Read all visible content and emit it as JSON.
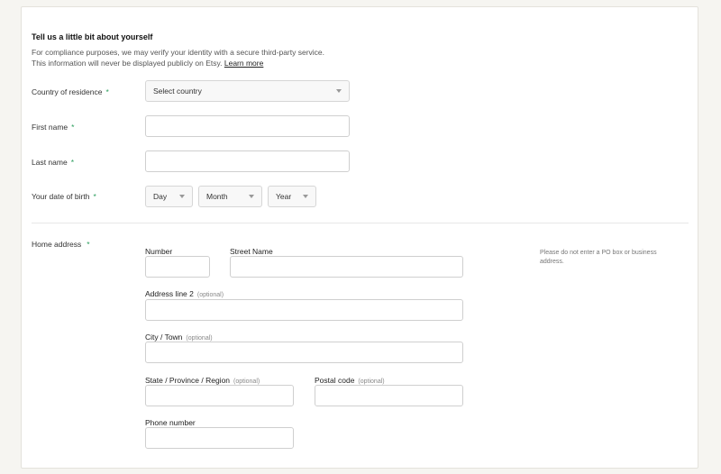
{
  "header": {
    "title": "Tell us a little bit about yourself",
    "description_line1": "For compliance purposes, we may verify your identity with a secure third-party service.",
    "description_line2": "This information will never be displayed publicly on Etsy.",
    "learn_more": "Learn more"
  },
  "required_marker": "*",
  "country": {
    "label": "Country of residence",
    "placeholder": "Select country"
  },
  "first_name": {
    "label": "First name",
    "value": ""
  },
  "last_name": {
    "label": "Last name",
    "value": ""
  },
  "dob": {
    "label": "Your date of birth",
    "day": "Day",
    "month": "Month",
    "year": "Year"
  },
  "address": {
    "label": "Home address",
    "number_label": "Number",
    "street_label": "Street Name",
    "line2_label": "Address line 2",
    "city_label": "City / Town",
    "state_label": "State / Province / Region",
    "postal_label": "Postal code",
    "phone_label": "Phone number",
    "optional": "(optional)",
    "note": "Please do not enter a PO box or business address."
  }
}
